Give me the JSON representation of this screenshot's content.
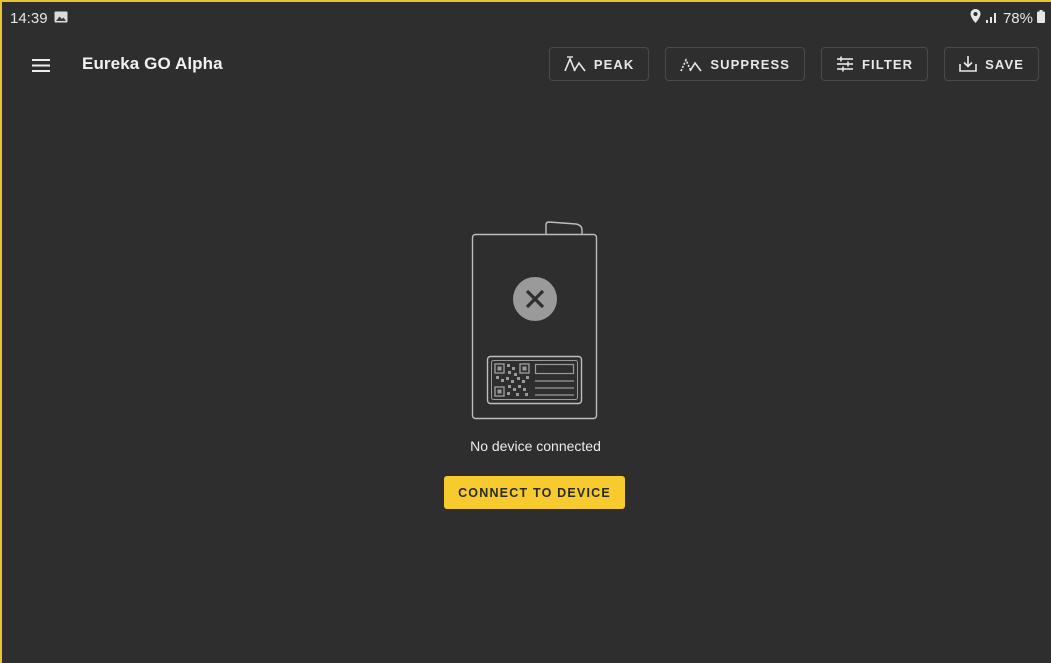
{
  "status_bar": {
    "time": "14:39",
    "battery": "78%",
    "icons": [
      "image-icon",
      "location-icon",
      "signal-icon",
      "battery-icon"
    ]
  },
  "app_bar": {
    "title": "Eureka GO Alpha",
    "menu_icon": "menu-icon",
    "actions": [
      {
        "label": "PEAK",
        "icon": "peak-icon"
      },
      {
        "label": "SUPPRESS",
        "icon": "suppress-icon"
      },
      {
        "label": "FILTER",
        "icon": "filter-icon"
      },
      {
        "label": "SAVE",
        "icon": "save-icon"
      }
    ]
  },
  "empty_state": {
    "message": "No device connected",
    "button_label": "CONNECT TO DEVICE",
    "illustration_icon": "disconnected-device-icon"
  },
  "colors": {
    "background": "#2e2e2e",
    "accent": "#f7ca2d",
    "border": "#e8c52e"
  }
}
